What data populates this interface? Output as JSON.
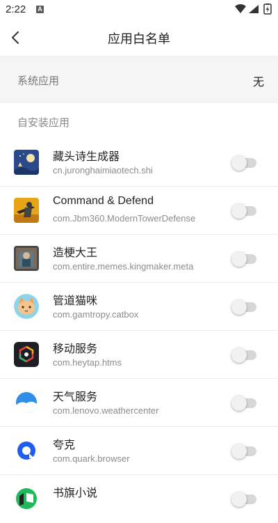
{
  "status_bar": {
    "time": "2:22",
    "notification_letter": "A"
  },
  "header": {
    "title": "应用白名单"
  },
  "system_apps": {
    "label": "系统应用",
    "value": "无"
  },
  "self_installed": {
    "label": "自安装应用",
    "apps": [
      {
        "name": "藏头诗生成器",
        "package": "cn.juronghaimiaotech.shi",
        "icon": "moon-night-icon",
        "enabled": false
      },
      {
        "name": "Command & Defend",
        "package": "com.Jbm360.ModernTowerDefense",
        "icon": "soldier-gun-icon",
        "enabled": false
      },
      {
        "name": "造梗大王",
        "package": "com.entire.memes.kingmaker.meta",
        "icon": "meme-photo-icon",
        "enabled": false
      },
      {
        "name": "管道猫咪",
        "package": "com.gamtropy.catbox",
        "icon": "cat-face-icon",
        "enabled": false
      },
      {
        "name": "移动服务",
        "package": "com.heytap.htms",
        "icon": "hexagon-service-icon",
        "enabled": false
      },
      {
        "name": "天气服务",
        "package": "com.lenovo.weathercenter",
        "icon": "weather-cloud-icon",
        "enabled": false
      },
      {
        "name": "夸克",
        "package": "com.quark.browser",
        "icon": "quark-logo-icon",
        "enabled": false
      },
      {
        "name": "书旗小说",
        "package": "",
        "icon": "book-flag-icon",
        "enabled": false
      }
    ]
  }
}
